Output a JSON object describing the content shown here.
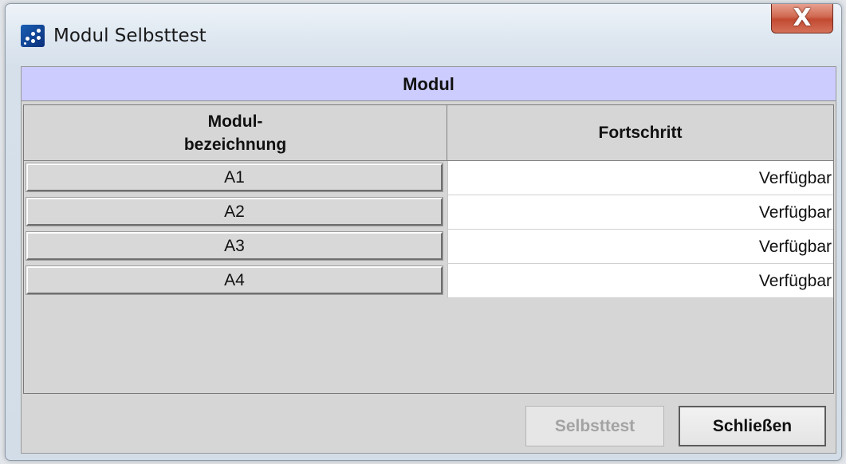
{
  "window": {
    "title": "Modul Selbsttest",
    "close_label": "X"
  },
  "group": {
    "title": "Modul"
  },
  "table": {
    "columns": [
      {
        "label": "Modul-\nbezeichnung"
      },
      {
        "label": "Fortschritt"
      }
    ],
    "rows": [
      {
        "name": "A1",
        "status": "Verfügbar"
      },
      {
        "name": "A2",
        "status": "Verfügbar"
      },
      {
        "name": "A3",
        "status": "Verfügbar"
      },
      {
        "name": "A4",
        "status": "Verfügbar"
      }
    ]
  },
  "buttons": {
    "selftest": "Selbsttest",
    "close": "Schließen"
  },
  "colors": {
    "group_header_bg": "#ccccff",
    "close_button": "#c24a31"
  },
  "icons": {
    "app": "app-dots-icon",
    "close": "close-icon"
  }
}
